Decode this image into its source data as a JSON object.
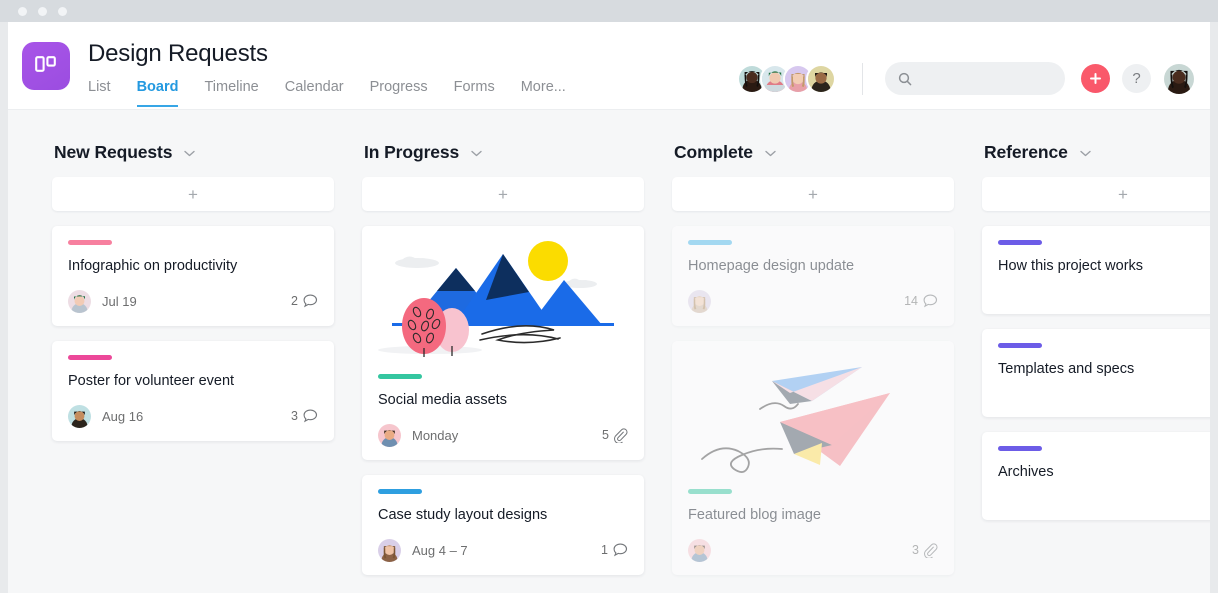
{
  "window": {
    "dots": [
      "close",
      "minimize",
      "maximize"
    ]
  },
  "header": {
    "logo_icon": "board-logo-icon",
    "title": "Design Requests",
    "tabs": [
      {
        "label": "List",
        "active": false
      },
      {
        "label": "Board",
        "active": true
      },
      {
        "label": "Timeline",
        "active": false
      },
      {
        "label": "Calendar",
        "active": false
      },
      {
        "label": "Progress",
        "active": false
      },
      {
        "label": "Forms",
        "active": false
      },
      {
        "label": "More...",
        "active": false
      }
    ],
    "members": [
      {
        "name": "member-1",
        "bg": "#bfdbda",
        "skin": "#4a2c1e",
        "hair": "#14100e"
      },
      {
        "name": "member-2",
        "bg": "#d8e7ec",
        "skin": "#f0c9b0",
        "hair": "#1c6b3a"
      },
      {
        "name": "member-3",
        "bg": "#d7c8ef",
        "skin": "#f3cdb4",
        "hair": "#c39a6b"
      },
      {
        "name": "member-4",
        "bg": "#ded6a2",
        "skin": "#9a6a45",
        "hair": "#231a14"
      }
    ],
    "search": {
      "placeholder": "",
      "value": "",
      "icon": "search-icon"
    },
    "add_button": {
      "label": "+",
      "icon": "plus-icon",
      "color": "#f8556a"
    },
    "help_button": {
      "label": "?",
      "icon": "question-mark-icon"
    },
    "account_avatar": {
      "name": "current-user-avatar",
      "bg": "#c8d7d4",
      "skin": "#4a2c1e",
      "hair": "#14100e"
    }
  },
  "board": {
    "columns": [
      {
        "title": "New Requests",
        "menu_icon": "chevron-down-icon",
        "add_label": "+",
        "cards": [
          {
            "title": "Infographic on productivity",
            "tag_color": "#f7809f",
            "date": "Jul 19",
            "count": "2",
            "count_icon": "comment-icon",
            "dim": false,
            "avatar": {
              "bg": "#eddde4",
              "skin": "#f2cbb5",
              "hair": "#1d6b3c"
            },
            "illustration": null
          },
          {
            "title": "Poster for volunteer event",
            "tag_color": "#ec4899",
            "date": "Aug 16",
            "count": "3",
            "count_icon": "comment-icon",
            "dim": false,
            "avatar": {
              "bg": "#bfe0e3",
              "skin": "#c58d5f",
              "hair": "#1b1410"
            },
            "illustration": null
          }
        ]
      },
      {
        "title": "In Progress",
        "menu_icon": "chevron-down-icon",
        "add_label": "+",
        "cards": [
          {
            "title": "Social media assets",
            "tag_color": "#34c6a0",
            "date": "Monday",
            "count": "5",
            "count_icon": "attachment-icon",
            "dim": false,
            "avatar": {
              "bg": "#f6c6cd",
              "skin": "#e9ab84",
              "hair": "#3c2a1c"
            },
            "illustration": "mountains"
          },
          {
            "title": "Case study layout designs",
            "tag_color": "#2e9fe0",
            "date": "Aug 4 – 7",
            "count": "1",
            "count_icon": "comment-icon",
            "dim": false,
            "avatar": {
              "bg": "#d9cfe8",
              "skin": "#f0c3a6",
              "hair": "#7c5534"
            },
            "illustration": null
          }
        ]
      },
      {
        "title": "Complete",
        "menu_icon": "chevron-down-icon",
        "add_label": "+",
        "cards": [
          {
            "title": "Homepage design update",
            "tag_color": "#4ab8ea",
            "date": "",
            "count": "14",
            "count_icon": "comment-icon",
            "dim": true,
            "avatar": {
              "bg": "#ddd3e6",
              "skin": "#f1cdb2",
              "hair": "#b08a5f"
            },
            "illustration": null
          },
          {
            "title": "Featured blog image",
            "tag_color": "#34c6a0",
            "date": "",
            "count": "3",
            "count_icon": "attachment-icon",
            "dim": true,
            "avatar": {
              "bg": "#f6c6cd",
              "skin": "#e9ab84",
              "hair": "#3c2a1c"
            },
            "illustration": "paper-planes"
          }
        ]
      },
      {
        "title": "Reference",
        "menu_icon": "chevron-down-icon",
        "add_label": "+",
        "cards": [
          {
            "title": "How this project works",
            "tag_color": "#6c5ce7",
            "date": "",
            "count": "",
            "count_icon": "",
            "dim": false,
            "avatar": null,
            "illustration": null,
            "tall": true
          },
          {
            "title": "Templates and specs",
            "tag_color": "#6c5ce7",
            "date": "",
            "count": "",
            "count_icon": "",
            "dim": false,
            "avatar": null,
            "illustration": null,
            "tall": true
          },
          {
            "title": "Archives",
            "tag_color": "#6c5ce7",
            "date": "",
            "count": "",
            "count_icon": "",
            "dim": false,
            "avatar": null,
            "illustration": null,
            "tall": true
          }
        ]
      }
    ]
  }
}
